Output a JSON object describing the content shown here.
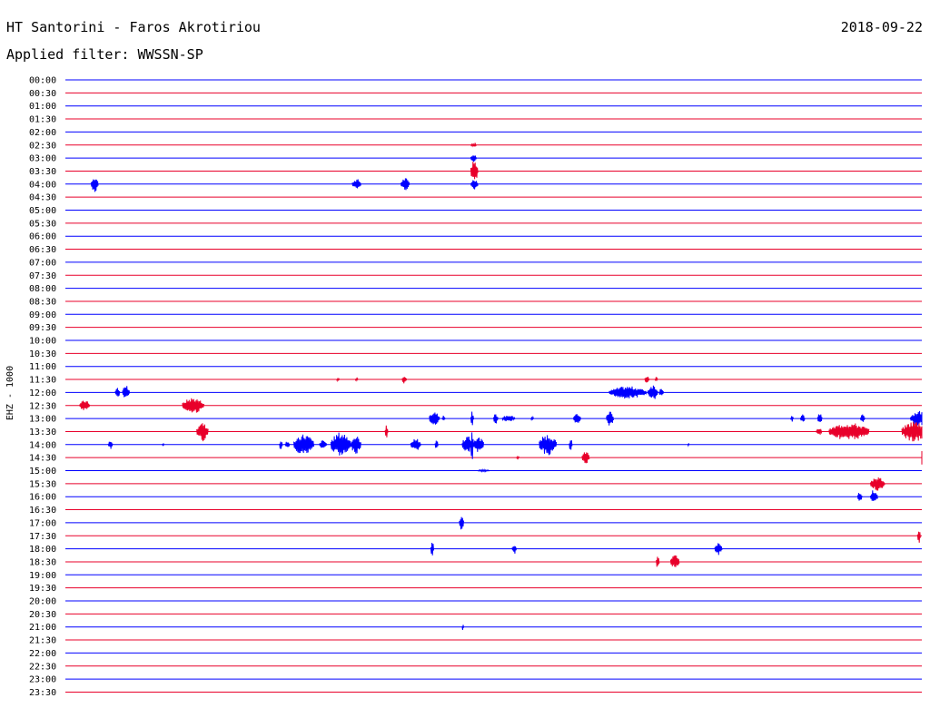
{
  "header": {
    "station": "HT Santorini - Faros Akrotiriou",
    "date": "2018-09-22",
    "filter": "Applied filter: WWSSN-SP"
  },
  "channel_label": "EHZ - 1000",
  "colors": {
    "blue_trace": "#0000ff",
    "red_trace": "#e8002a",
    "text": "#000000",
    "background": "#ffffff"
  },
  "chart_data": {
    "type": "line",
    "title": "",
    "xlabel": "",
    "ylabel": "EHZ - 1000",
    "x_unit": "minutes into half-hour window",
    "xlim": [
      0,
      30
    ],
    "rows": [
      "00:00",
      "00:30",
      "01:00",
      "01:30",
      "02:00",
      "02:30",
      "03:00",
      "03:30",
      "04:00",
      "04:30",
      "05:00",
      "05:30",
      "06:00",
      "06:30",
      "07:00",
      "07:30",
      "08:00",
      "08:30",
      "09:00",
      "09:30",
      "10:00",
      "10:30",
      "11:00",
      "11:30",
      "12:00",
      "12:30",
      "13:00",
      "13:30",
      "14:00",
      "14:30",
      "15:00",
      "15:30",
      "16:00",
      "16:30",
      "17:00",
      "17:30",
      "18:00",
      "18:30",
      "19:00",
      "19:30",
      "20:00",
      "20:30",
      "21:00",
      "21:30",
      "22:00",
      "22:30",
      "23:00",
      "23:30"
    ],
    "row_colors": [
      "blue",
      "red"
    ],
    "grid": false,
    "events": [
      {
        "row": "02:30",
        "start": 14.2,
        "duration": 0.2,
        "amplitude": 2
      },
      {
        "row": "03:00",
        "start": 14.2,
        "duration": 0.2,
        "amplitude": 5
      },
      {
        "row": "03:30",
        "start": 14.2,
        "duration": 0.25,
        "amplitude": 12
      },
      {
        "row": "04:00",
        "start": 0.9,
        "duration": 0.25,
        "amplitude": 9
      },
      {
        "row": "04:00",
        "start": 10.05,
        "duration": 0.3,
        "amplitude": 6
      },
      {
        "row": "04:00",
        "start": 11.75,
        "duration": 0.3,
        "amplitude": 7
      },
      {
        "row": "04:00",
        "start": 14.2,
        "duration": 0.25,
        "amplitude": 6
      },
      {
        "row": "11:30",
        "start": 9.5,
        "duration": 0.1,
        "amplitude": 2
      },
      {
        "row": "11:30",
        "start": 10.15,
        "duration": 0.1,
        "amplitude": 2
      },
      {
        "row": "11:30",
        "start": 11.8,
        "duration": 0.15,
        "amplitude": 5
      },
      {
        "row": "11:30",
        "start": 20.3,
        "duration": 0.15,
        "amplitude": 5
      },
      {
        "row": "11:30",
        "start": 20.65,
        "duration": 0.1,
        "amplitude": 3
      },
      {
        "row": "12:00",
        "start": 1.75,
        "duration": 0.15,
        "amplitude": 7
      },
      {
        "row": "12:00",
        "start": 2.0,
        "duration": 0.25,
        "amplitude": 8
      },
      {
        "row": "12:00",
        "start": 19.05,
        "duration": 1.3,
        "amplitude": 7
      },
      {
        "row": "12:00",
        "start": 20.4,
        "duration": 0.35,
        "amplitude": 9
      },
      {
        "row": "12:00",
        "start": 20.8,
        "duration": 0.15,
        "amplitude": 5
      },
      {
        "row": "12:30",
        "start": 0.5,
        "duration": 0.35,
        "amplitude": 6
      },
      {
        "row": "12:30",
        "start": 4.1,
        "duration": 0.75,
        "amplitude": 9
      },
      {
        "row": "13:00",
        "start": 12.75,
        "duration": 0.35,
        "amplitude": 9
      },
      {
        "row": "13:00",
        "start": 13.2,
        "duration": 0.1,
        "amplitude": 4
      },
      {
        "row": "13:00",
        "start": 14.2,
        "duration": 0.1,
        "amplitude": 8
      },
      {
        "row": "13:00",
        "start": 15.0,
        "duration": 0.15,
        "amplitude": 6
      },
      {
        "row": "13:00",
        "start": 15.3,
        "duration": 0.45,
        "amplitude": 4
      },
      {
        "row": "13:00",
        "start": 16.3,
        "duration": 0.1,
        "amplitude": 3
      },
      {
        "row": "13:00",
        "start": 17.8,
        "duration": 0.25,
        "amplitude": 6
      },
      {
        "row": "13:00",
        "start": 18.95,
        "duration": 0.25,
        "amplitude": 9
      },
      {
        "row": "13:00",
        "start": 25.4,
        "duration": 0.1,
        "amplitude": 4
      },
      {
        "row": "13:00",
        "start": 25.75,
        "duration": 0.15,
        "amplitude": 5
      },
      {
        "row": "13:00",
        "start": 26.35,
        "duration": 0.15,
        "amplitude": 6
      },
      {
        "row": "13:00",
        "start": 27.85,
        "duration": 0.15,
        "amplitude": 5
      },
      {
        "row": "13:00",
        "start": 29.6,
        "duration": 0.6,
        "amplitude": 9
      },
      {
        "row": "13:30",
        "start": 4.6,
        "duration": 0.4,
        "amplitude": 11
      },
      {
        "row": "13:30",
        "start": 11.2,
        "duration": 0.1,
        "amplitude": 7
      },
      {
        "row": "13:30",
        "start": 26.3,
        "duration": 0.2,
        "amplitude": 4
      },
      {
        "row": "13:30",
        "start": 26.75,
        "duration": 1.4,
        "amplitude": 10
      },
      {
        "row": "13:30",
        "start": 29.3,
        "duration": 0.9,
        "amplitude": 12
      },
      {
        "row": "14:00",
        "start": 1.5,
        "duration": 0.15,
        "amplitude": 5
      },
      {
        "row": "14:00",
        "start": 3.4,
        "duration": 0.05,
        "amplitude": 3
      },
      {
        "row": "14:00",
        "start": 7.5,
        "duration": 0.1,
        "amplitude": 7
      },
      {
        "row": "14:00",
        "start": 7.7,
        "duration": 0.15,
        "amplitude": 4
      },
      {
        "row": "14:00",
        "start": 8.0,
        "duration": 0.7,
        "amplitude": 12
      },
      {
        "row": "14:00",
        "start": 8.9,
        "duration": 0.25,
        "amplitude": 5
      },
      {
        "row": "14:00",
        "start": 9.3,
        "duration": 0.7,
        "amplitude": 14
      },
      {
        "row": "14:00",
        "start": 10.0,
        "duration": 0.35,
        "amplitude": 10
      },
      {
        "row": "14:00",
        "start": 12.1,
        "duration": 0.35,
        "amplitude": 7
      },
      {
        "row": "14:00",
        "start": 12.95,
        "duration": 0.1,
        "amplitude": 6
      },
      {
        "row": "14:00",
        "start": 13.9,
        "duration": 0.35,
        "amplitude": 10
      },
      {
        "row": "14:00",
        "start": 14.3,
        "duration": 0.35,
        "amplitude": 9
      },
      {
        "row": "14:00",
        "start": 16.6,
        "duration": 0.6,
        "amplitude": 12
      },
      {
        "row": "14:00",
        "start": 17.65,
        "duration": 0.1,
        "amplitude": 7
      },
      {
        "row": "14:00",
        "start": 21.8,
        "duration": 0.05,
        "amplitude": 2
      },
      {
        "row": "14:00",
        "start": 14.2,
        "duration": 0.1,
        "amplitude": 18
      },
      {
        "row": "14:30",
        "start": 15.8,
        "duration": 0.1,
        "amplitude": 2
      },
      {
        "row": "14:30",
        "start": 18.1,
        "duration": 0.25,
        "amplitude": 7
      },
      {
        "row": "14:30",
        "start": 30.1,
        "duration": 0.55,
        "amplitude": 8
      },
      {
        "row": "15:00",
        "start": 14.45,
        "duration": 0.4,
        "amplitude": 1
      },
      {
        "row": "15:30",
        "start": 28.2,
        "duration": 0.5,
        "amplitude": 8
      },
      {
        "row": "16:00",
        "start": 27.75,
        "duration": 0.15,
        "amplitude": 6
      },
      {
        "row": "16:00",
        "start": 28.2,
        "duration": 0.25,
        "amplitude": 8
      },
      {
        "row": "17:00",
        "start": 13.8,
        "duration": 0.15,
        "amplitude": 8
      },
      {
        "row": "17:30",
        "start": 29.85,
        "duration": 0.1,
        "amplitude": 8
      },
      {
        "row": "18:00",
        "start": 12.8,
        "duration": 0.1,
        "amplitude": 9
      },
      {
        "row": "18:00",
        "start": 15.65,
        "duration": 0.15,
        "amplitude": 6
      },
      {
        "row": "18:00",
        "start": 22.75,
        "duration": 0.25,
        "amplitude": 7
      },
      {
        "row": "18:30",
        "start": 20.7,
        "duration": 0.1,
        "amplitude": 8
      },
      {
        "row": "18:30",
        "start": 21.2,
        "duration": 0.3,
        "amplitude": 8
      },
      {
        "row": "21:00",
        "start": 13.9,
        "duration": 0.05,
        "amplitude": 4
      }
    ]
  }
}
